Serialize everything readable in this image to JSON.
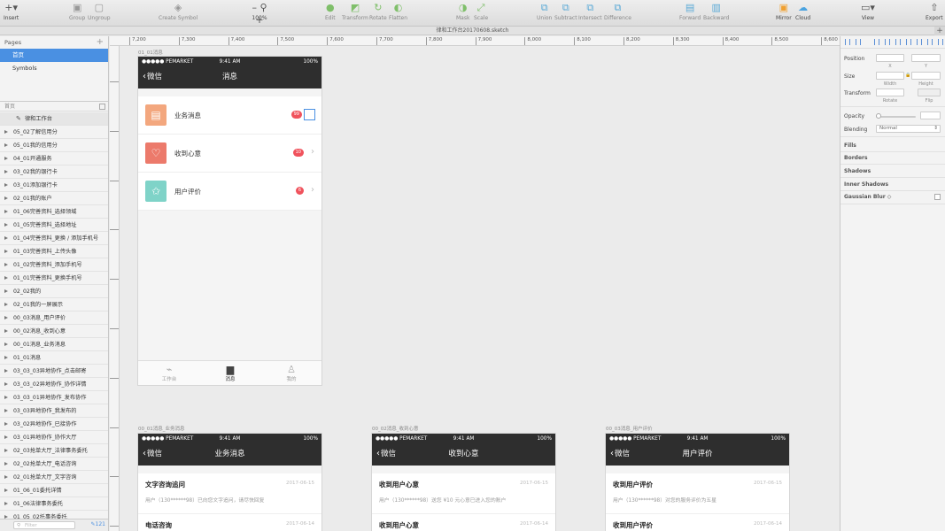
{
  "toolbar": {
    "insert": "Insert",
    "group": "Group",
    "ungroup": "Ungroup",
    "create_symbol": "Create Symbol",
    "zoom": "100%",
    "edit": "Edit",
    "transform": "Transform",
    "rotate": "Rotate",
    "flatten": "Flatten",
    "mask": "Mask",
    "scale": "Scale",
    "union": "Union",
    "subtract": "Subtract",
    "intersect": "Intersect",
    "difference": "Difference",
    "forward": "Forward",
    "backward": "Backward",
    "mirror": "Mirror",
    "cloud": "Cloud",
    "view": "View",
    "export": "Export"
  },
  "document_title": "律和工作台20170608.sketch",
  "pages_panel": {
    "header": "Pages",
    "pages": [
      "首页",
      "Symbols"
    ]
  },
  "layers_panel": {
    "header": "首页",
    "artboard": "律和工作台",
    "layers": [
      "05_02了解信用分",
      "05_01我的信用分",
      "04_01开通服务",
      "03_02我的银行卡",
      "03_01添加银行卡",
      "02_01我的账户",
      "01_06完善资料_选择领域",
      "01_05完善资料_选择地址",
      "01_04完善资料_更换 / 添加手机号",
      "01_03完善资料_上传头像",
      "01_02完善资料_添加手机号",
      "01_01完善资料_更换手机号",
      "02_02我的",
      "02_01我的一屏展示",
      "00_03消息_用户评价",
      "00_02消息_收到心意",
      "00_01消息_业务消息",
      "01_01消息",
      "03_03_03异地协作_点击邮寄",
      "03_03_02异地协作_协作详情",
      "03_03_01异地协作_发布协作",
      "03_03异地协作_我发布的",
      "03_02异地协作_已接协作",
      "03_01异地协作_协作大厅",
      "02_03抢单大厅_法律事务委托",
      "02_02抢单大厅_电话咨询",
      "02_01抢单大厅_文字咨询",
      "01_06_01委托详情",
      "01_06法律事务委托",
      "01_05_02托事务委托"
    ],
    "filter_placeholder": "Filter",
    "count": "121"
  },
  "rulers": {
    "top": [
      "7,200",
      "7,300",
      "7,400",
      "7,500",
      "7,600",
      "7,700",
      "7,800",
      "7,900",
      "8,000",
      "8,100",
      "8,200",
      "8,300",
      "8,400",
      "8,500",
      "8,600"
    ],
    "left": [
      "-400",
      "-300",
      "-200",
      "-100",
      "0",
      "100",
      "200",
      "300",
      "400",
      "500"
    ]
  },
  "main_artboard": {
    "label": "01_01消息",
    "status": {
      "carrier": "●●●●● PEMARKET",
      "time": "9:41 AM",
      "battery": "100%"
    },
    "back": "微信",
    "title": "消息",
    "rows": [
      {
        "label": "业务消息",
        "badge": "99",
        "color": "#f3a77e"
      },
      {
        "label": "收到心意",
        "badge": "10",
        "color": "#ec7a6b"
      },
      {
        "label": "用户评价",
        "badge": "6",
        "color": "#7fd3c8"
      }
    ],
    "tabs": [
      "工作台",
      "消息",
      "我的"
    ]
  },
  "detail_artboards": [
    {
      "label": "00_01消息_业务消息",
      "title": "业务消息",
      "items": [
        {
          "title": "文字咨询追问",
          "date": "2017-06-15",
          "text": "用户（130******98）已向您文字追问，请尽快回复"
        },
        {
          "title": "电话咨询",
          "date": "2017-06-14",
          "text": ""
        }
      ]
    },
    {
      "label": "00_02消息_收到心意",
      "title": "收到心意",
      "items": [
        {
          "title": "收到用户心意",
          "date": "2017-06-15",
          "text": "用户（130******98）送您 ¥10 元心意已进入您的账户"
        },
        {
          "title": "收到用户心意",
          "date": "2017-06-14",
          "text": ""
        }
      ]
    },
    {
      "label": "00_03消息_用户评价",
      "title": "用户评价",
      "items": [
        {
          "title": "收到用户评价",
          "date": "2017-06-15",
          "text": "用户（130******98）对您的服务评价为五星"
        },
        {
          "title": "收到用户评价",
          "date": "2017-06-14",
          "text": ""
        }
      ]
    }
  ],
  "inspector": {
    "position": "Position",
    "x": "X",
    "y": "Y",
    "size": "Size",
    "width": "Width",
    "height": "Height",
    "transform": "Transform",
    "rotate": "Rotate",
    "flip": "Flip",
    "opacity": "Opacity",
    "blending": "Blending",
    "blending_value": "Normal",
    "fills": "Fills",
    "borders": "Borders",
    "shadows": "Shadows",
    "inner_shadows": "Inner Shadows",
    "gaussian_blur": "Gaussian Blur"
  }
}
